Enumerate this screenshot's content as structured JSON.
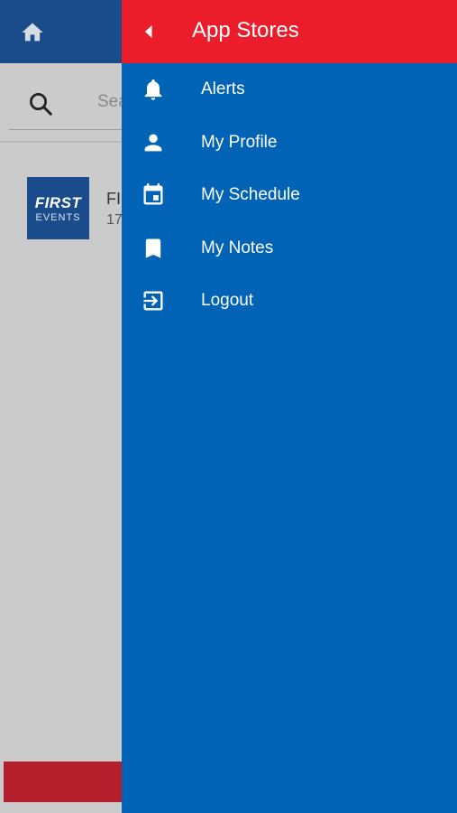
{
  "background_app": {
    "home_icon": "home-icon",
    "search": {
      "icon": "search-icon",
      "placeholder": "Sea"
    },
    "event": {
      "logo_top": "FIRST",
      "logo_bottom": "EVENTS",
      "title": "FI",
      "subtitle": "17"
    },
    "colors": {
      "header": "#1a4c8c",
      "bottom_bar": "#b3202b"
    }
  },
  "drawer": {
    "title": "App Stores",
    "back_icon": "back-arrow-icon",
    "colors": {
      "header": "#ec1d2b",
      "background": "#0063b5",
      "text": "#ffffff"
    },
    "items": [
      {
        "label": "Alerts",
        "icon": "bell-icon"
      },
      {
        "label": "My Profile",
        "icon": "person-icon"
      },
      {
        "label": "My Schedule",
        "icon": "calendar-icon"
      },
      {
        "label": "My Notes",
        "icon": "bookmark-icon"
      },
      {
        "label": "Logout",
        "icon": "logout-icon"
      }
    ]
  }
}
